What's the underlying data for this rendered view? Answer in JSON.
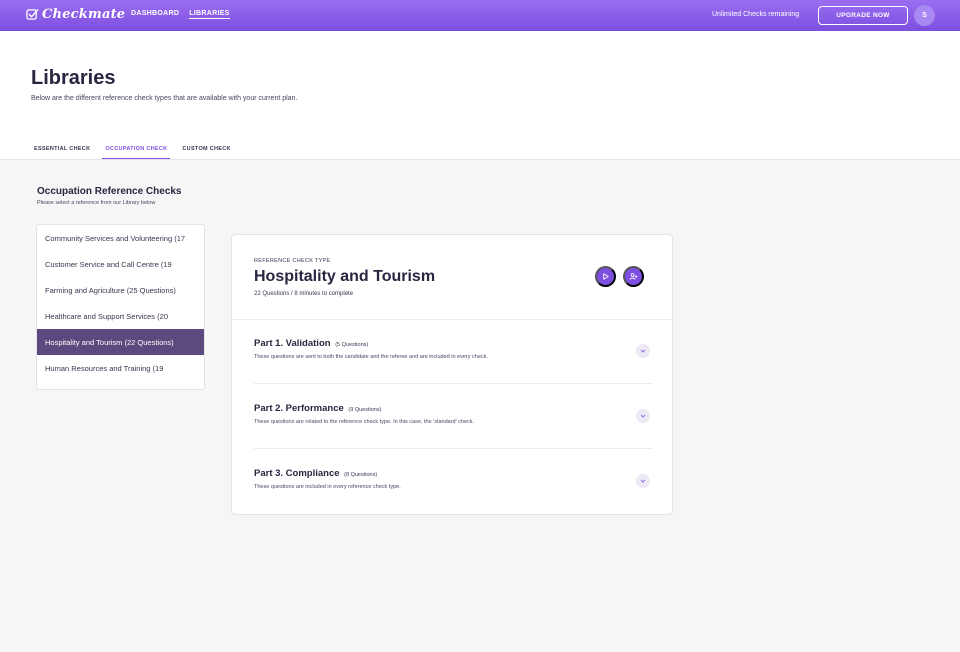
{
  "brand": {
    "name": "Checkmate",
    "accent": "#7d4fe0",
    "active_item_bg": "#5c4a7e"
  },
  "nav": {
    "items": [
      "DASHBOARD",
      "LIBRARIES"
    ],
    "active": "LIBRARIES"
  },
  "account": {
    "checks_remaining": "Unlimited Checks remaining",
    "upgrade_label": "UPGRADE NOW",
    "avatar_initial": "S"
  },
  "page": {
    "title": "Libraries",
    "subtitle": "Below are the different reference check types that are available with your current plan."
  },
  "tabs": [
    {
      "label": "ESSENTIAL CHECK",
      "active": false
    },
    {
      "label": "OCCUPATION CHECK",
      "active": true
    },
    {
      "label": "CUSTOM CHECK",
      "active": false
    }
  ],
  "section": {
    "title": "Occupation Reference Checks",
    "subtitle": "Please select a reference from our Library below"
  },
  "library_list": [
    "Community Services and Volunteering (17",
    "Customer Service and Call Centre (19",
    "Farming and Agriculture (25 Questions)",
    "Healthcare and Support Services (20",
    "Hospitality and Tourism (22 Questions)",
    "Human Resources and Training (19"
  ],
  "library_selected": "Hospitality and Tourism (22 Questions)",
  "detail": {
    "eyebrow": "REFERENCE CHECK TYPE",
    "title": "Hospitality and Tourism",
    "meta": "22 Questions / 8 minutes to complete",
    "actions": [
      {
        "name": "play-icon"
      },
      {
        "name": "add-user-icon"
      }
    ],
    "parts": [
      {
        "title": "Part 1. Validation",
        "count": "(5 Questions)",
        "description": "These questions are sent to both the candidate and the referee and are included in every check."
      },
      {
        "title": "Part 2. Performance",
        "count": "(9 Questions)",
        "description": "These questions are related to the reference check type. In this case, the 'standard' check."
      },
      {
        "title": "Part 3. Compliance",
        "count": "(8 Questions)",
        "description": "These questions are included in every reference check type."
      }
    ]
  }
}
